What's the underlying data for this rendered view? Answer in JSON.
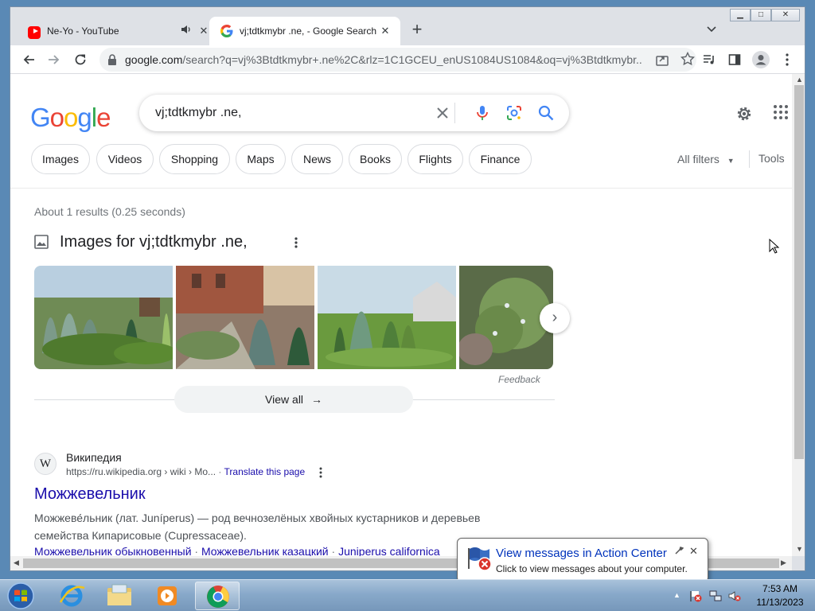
{
  "browser": {
    "tabs": [
      {
        "title": "Ne-Yo - YouTube",
        "active": false,
        "audio": true
      },
      {
        "title": "vj;tdtkmybr .ne, - Google Search",
        "active": true
      }
    ],
    "new_tab_label": "+",
    "url_host": "google.com",
    "url_rest": "/search?q=vj%3Btdtkmybr+.ne%2C&rlz=1C1GCEU_enUS1084US1084&oq=vj%3Btdtkmybr..."
  },
  "search": {
    "logo": "Google",
    "query": "vj;tdtkmybr .ne,"
  },
  "chips": [
    "Images",
    "Videos",
    "Shopping",
    "Maps",
    "News",
    "Books",
    "Flights",
    "Finance"
  ],
  "all_filters": "All filters",
  "tools": "Tools",
  "stats": "About 1 results (0.25 seconds)",
  "images": {
    "heading": "Images for vj;tdtkmybr .ne,",
    "feedback": "Feedback",
    "view_all": "View all"
  },
  "result": {
    "favicon": "W",
    "site": "Википедия",
    "url": "https://ru.wikipedia.org › wiki › Mo...",
    "translate": "Translate this page",
    "title": "Можжевельник",
    "snippet": "Можжеве́льник (лат. Juníperus) — род вечнозелёных хвойных кустарников и деревьев семейства Кипарисовые (Cupressaceae).",
    "links": [
      "Можжевельник обыкновенный",
      "Можжевельник казацкий",
      "Juniperus californica"
    ]
  },
  "balloon": {
    "title": "View messages in Action Center",
    "text": "Click to view messages about your computer."
  },
  "taskbar": {
    "time": "7:53 AM",
    "date": "11/13/2023"
  },
  "colors": {
    "link": "#1a0dab",
    "google_blue": "#4285f4",
    "google_red": "#ea4335",
    "google_yellow": "#fbbc05",
    "google_green": "#34a853"
  }
}
